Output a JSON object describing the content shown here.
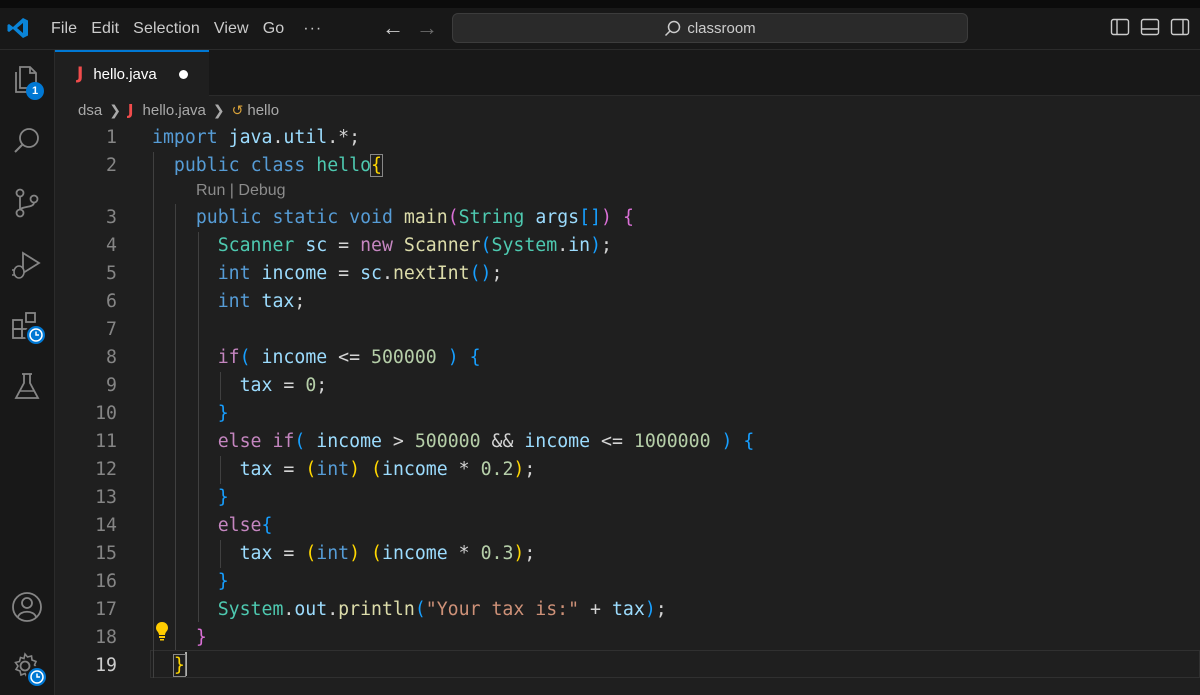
{
  "titlebar": {
    "menu": [
      "File",
      "Edit",
      "Selection",
      "View",
      "Go",
      "···"
    ],
    "search_text": "classroom"
  },
  "activity": {
    "explorer_badge": "1"
  },
  "tab": {
    "filename": "hello.java",
    "language_icon": "J",
    "unsaved": true
  },
  "breadcrumb": {
    "folder": "dsa",
    "file": "hello.java",
    "symbol": "hello"
  },
  "codelens": "Run | Debug",
  "editor": {
    "active_line": 19,
    "lines": [
      {
        "n": "1",
        "tokens": [
          [
            "kw",
            "import"
          ],
          [
            "op",
            " "
          ],
          [
            "var",
            "java"
          ],
          [
            "op",
            "."
          ],
          [
            "var",
            "util"
          ],
          [
            "op",
            ".*;"
          ]
        ]
      },
      {
        "n": "2",
        "tokens": [
          [
            "op",
            "  "
          ],
          [
            "kw",
            "public"
          ],
          [
            "op",
            " "
          ],
          [
            "kw",
            "class"
          ],
          [
            "op",
            " "
          ],
          [
            "typ",
            "hello"
          ],
          [
            "bb1",
            "{"
          ]
        ]
      },
      {
        "n": "3",
        "tokens": [
          [
            "op",
            "    "
          ],
          [
            "kw",
            "public"
          ],
          [
            "op",
            " "
          ],
          [
            "kw",
            "static"
          ],
          [
            "op",
            " "
          ],
          [
            "kw",
            "void"
          ],
          [
            "op",
            " "
          ],
          [
            "fn",
            "main"
          ],
          [
            "b2",
            "("
          ],
          [
            "typ",
            "String"
          ],
          [
            "op",
            " "
          ],
          [
            "var",
            "args"
          ],
          [
            "b3",
            "[]"
          ],
          [
            "b2",
            ")"
          ],
          [
            "op",
            " "
          ],
          [
            "b2",
            "{"
          ]
        ]
      },
      {
        "n": "4",
        "tokens": [
          [
            "op",
            "      "
          ],
          [
            "typ",
            "Scanner"
          ],
          [
            "op",
            " "
          ],
          [
            "var",
            "sc"
          ],
          [
            "op",
            " = "
          ],
          [
            "ctl",
            "new"
          ],
          [
            "op",
            " "
          ],
          [
            "fn",
            "Scanner"
          ],
          [
            "b3",
            "("
          ],
          [
            "typ",
            "System"
          ],
          [
            "op",
            "."
          ],
          [
            "var",
            "in"
          ],
          [
            "b3",
            ")"
          ],
          [
            "op",
            ";"
          ]
        ]
      },
      {
        "n": "5",
        "tokens": [
          [
            "op",
            "      "
          ],
          [
            "kw",
            "int"
          ],
          [
            "op",
            " "
          ],
          [
            "var",
            "income"
          ],
          [
            "op",
            " = "
          ],
          [
            "var",
            "sc"
          ],
          [
            "op",
            "."
          ],
          [
            "fn",
            "nextInt"
          ],
          [
            "b3",
            "()"
          ],
          [
            "op",
            ";"
          ]
        ]
      },
      {
        "n": "6",
        "tokens": [
          [
            "op",
            "      "
          ],
          [
            "kw",
            "int"
          ],
          [
            "op",
            " "
          ],
          [
            "var",
            "tax"
          ],
          [
            "op",
            ";"
          ]
        ]
      },
      {
        "n": "7",
        "tokens": []
      },
      {
        "n": "8",
        "tokens": [
          [
            "op",
            "      "
          ],
          [
            "ctl",
            "if"
          ],
          [
            "b3",
            "("
          ],
          [
            "op",
            " "
          ],
          [
            "var",
            "income"
          ],
          [
            "op",
            " <= "
          ],
          [
            "num",
            "500000"
          ],
          [
            "op",
            " "
          ],
          [
            "b3",
            ")"
          ],
          [
            "op",
            " "
          ],
          [
            "b3",
            "{"
          ]
        ]
      },
      {
        "n": "9",
        "tokens": [
          [
            "op",
            "        "
          ],
          [
            "var",
            "tax"
          ],
          [
            "op",
            " = "
          ],
          [
            "num",
            "0"
          ],
          [
            "op",
            ";"
          ]
        ]
      },
      {
        "n": "10",
        "tokens": [
          [
            "op",
            "      "
          ],
          [
            "b3",
            "}"
          ]
        ]
      },
      {
        "n": "11",
        "tokens": [
          [
            "op",
            "      "
          ],
          [
            "ctl",
            "else"
          ],
          [
            "op",
            " "
          ],
          [
            "ctl",
            "if"
          ],
          [
            "b3",
            "("
          ],
          [
            "op",
            " "
          ],
          [
            "var",
            "income"
          ],
          [
            "op",
            " > "
          ],
          [
            "num",
            "500000"
          ],
          [
            "op",
            " && "
          ],
          [
            "var",
            "income"
          ],
          [
            "op",
            " <= "
          ],
          [
            "num",
            "1000000"
          ],
          [
            "op",
            " "
          ],
          [
            "b3",
            ")"
          ],
          [
            "op",
            " "
          ],
          [
            "b3",
            "{"
          ]
        ]
      },
      {
        "n": "12",
        "tokens": [
          [
            "op",
            "        "
          ],
          [
            "var",
            "tax"
          ],
          [
            "op",
            " = "
          ],
          [
            "b1",
            "("
          ],
          [
            "kw",
            "int"
          ],
          [
            "b1",
            ")"
          ],
          [
            "op",
            " "
          ],
          [
            "b1",
            "("
          ],
          [
            "var",
            "income"
          ],
          [
            "op",
            " * "
          ],
          [
            "num",
            "0.2"
          ],
          [
            "b1",
            ")"
          ],
          [
            "op",
            ";"
          ]
        ]
      },
      {
        "n": "13",
        "tokens": [
          [
            "op",
            "      "
          ],
          [
            "b3",
            "}"
          ]
        ]
      },
      {
        "n": "14",
        "tokens": [
          [
            "op",
            "      "
          ],
          [
            "ctl",
            "else"
          ],
          [
            "b3",
            "{"
          ]
        ]
      },
      {
        "n": "15",
        "tokens": [
          [
            "op",
            "        "
          ],
          [
            "var",
            "tax"
          ],
          [
            "op",
            " = "
          ],
          [
            "b1",
            "("
          ],
          [
            "kw",
            "int"
          ],
          [
            "b1",
            ")"
          ],
          [
            "op",
            " "
          ],
          [
            "b1",
            "("
          ],
          [
            "var",
            "income"
          ],
          [
            "op",
            " * "
          ],
          [
            "num",
            "0.3"
          ],
          [
            "b1",
            ")"
          ],
          [
            "op",
            ";"
          ]
        ]
      },
      {
        "n": "16",
        "tokens": [
          [
            "op",
            "      "
          ],
          [
            "b3",
            "}"
          ]
        ]
      },
      {
        "n": "17",
        "tokens": [
          [
            "op",
            "      "
          ],
          [
            "typ",
            "System"
          ],
          [
            "op",
            "."
          ],
          [
            "var",
            "out"
          ],
          [
            "op",
            "."
          ],
          [
            "fn",
            "println"
          ],
          [
            "b3",
            "("
          ],
          [
            "str",
            "\"Your tax is:\""
          ],
          [
            "op",
            " + "
          ],
          [
            "var",
            "tax"
          ],
          [
            "b3",
            ")"
          ],
          [
            "op",
            ";"
          ]
        ]
      },
      {
        "n": "18",
        "tokens": [
          [
            "op",
            "    "
          ],
          [
            "b2",
            "}"
          ]
        ]
      },
      {
        "n": "19",
        "tokens": [
          [
            "op",
            "  "
          ],
          [
            "bb1",
            "}"
          ]
        ]
      }
    ]
  }
}
